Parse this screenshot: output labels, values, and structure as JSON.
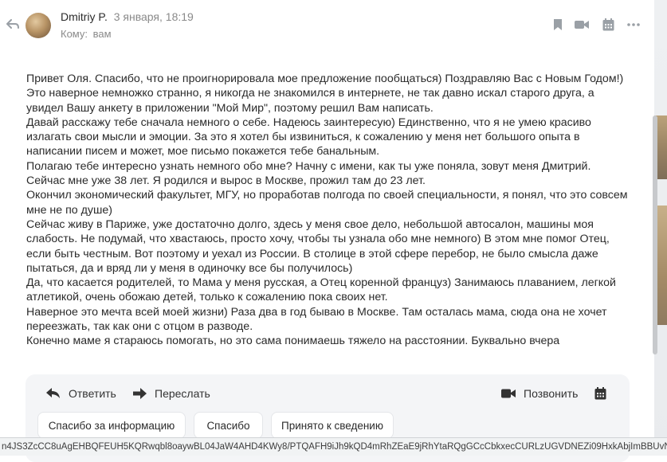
{
  "header": {
    "sender_name": "Dmitriy P.",
    "date": "3 января, 18:19",
    "recipient_label": "Кому:",
    "recipient_value": "вам"
  },
  "icons": {
    "back": "reply-arrow-icon",
    "bookmark": "bookmark-icon",
    "video": "video-camera-icon",
    "calendar": "calendar-icon",
    "more": "more-dots-icon"
  },
  "message": {
    "lines": [
      "Привет Оля. Спасибо, что не проигнорировала мое предложение пообщаться) Поздравляю Вас с Новым Годом!)",
      "Это наверное немножко странно, я никогда не знакомился в интернете, не так давно искал старого друга, а увидел Вашу анкету в приложении \"Мой Мир\", поэтому решил Вам написать.",
      "Давай расскажу тебе сначала немного о себе. Надеюсь заинтересую) Единственно, что я не умею красиво излагать свои мысли и эмоции. За это я хотел бы извиниться, к сожалению у меня нет большого опыта в написании писем и может, мое письмо покажется тебе банальным.",
      "Полагаю тебе интересно узнать немного обо мне? Начну с имени, как ты уже поняла, зовут меня Дмитрий.",
      "Сейчас мне уже 38 лет. Я родился и вырос в Москве, прожил там до 23 лет.",
      "Окончил экономический факультет, МГУ, но проработав полгода по своей специальности, я понял, что это совсем мне не по душе)",
      "Сейчас живу в Париже, уже достаточно долго, здесь у меня свое дело, небольшой автосалон, машины моя слабость. Не подумай, что хвастаюсь, просто хочу, чтобы ты узнала обо мне немного) В этом мне помог Отец, если быть честным. Вот поэтому и уехал из России. В столице в этой сфере перебор, не было смысла даже пытаться, да и вряд ли у меня в одиночку все бы получилось)",
      "Да, что касается родителей, то Мама у меня русская, а Отец коренной француз) Занимаюсь плаванием, легкой атлетикой, очень обожаю детей, только к сожалению пока своих нет.",
      "Наверное это мечта всей моей жизни) Раза два в год бываю в Москве. Там осталась мама, сюда она не хочет переезжать, так как они с отцом в разводе.",
      "Конечно маме я стараюсь помогать, но это сама понимаешь тяжело на расстоянии. Буквально вчера"
    ]
  },
  "actions": {
    "reply": "Ответить",
    "forward": "Переслать",
    "call": "Позвонить"
  },
  "quick_replies": [
    "Спасибо за информацию",
    "Спасибо",
    "Принято к сведению"
  ],
  "status_url": "n4JS3ZcCC8uAgEHBQFEUH5KQRwqbl8oaywBL04JaW4AHD4KWy8/PTQAFH9iJh9kQD4mRhZEaE9jRhYtaRQgGCcCbkxecCURLzUGVDNEZi09HxkAbjImBBUvNF4V",
  "colors": {
    "text": "#2a2a2a",
    "muted": "#8a8a8a",
    "panel": "#f4f5f7"
  }
}
